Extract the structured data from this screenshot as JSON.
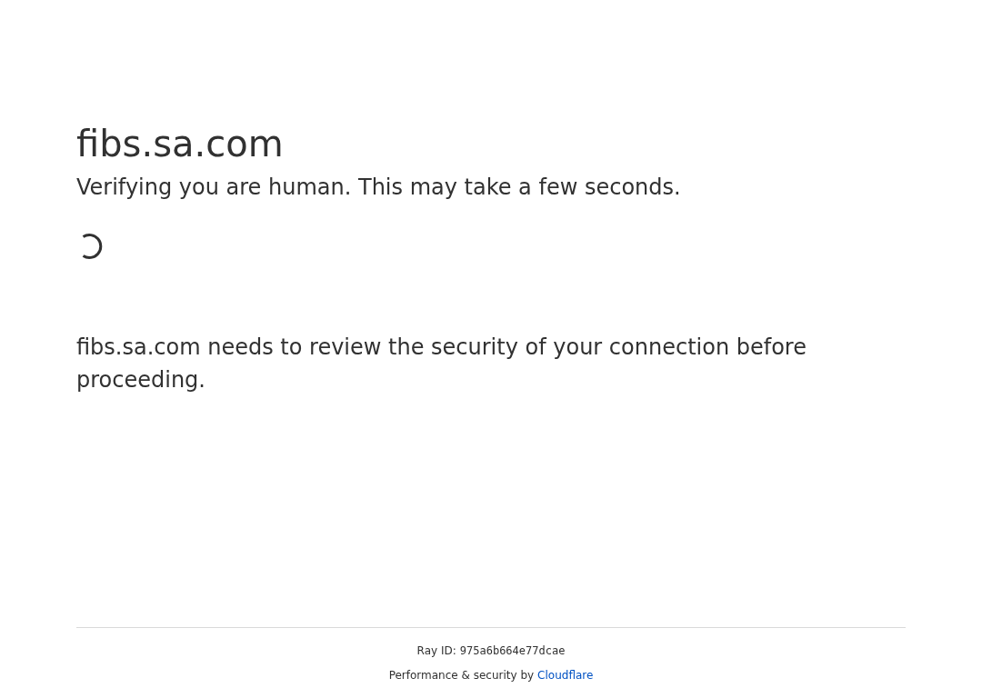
{
  "title": "fibs.sa.com",
  "subtitle": "Verifying you are human. This may take a few seconds.",
  "message": "fibs.sa.com needs to review the security of your connection before proceeding.",
  "footer": {
    "ray_id_label": "Ray ID:",
    "ray_id": "975a6b664e77dcae",
    "credit": "Performance & security by",
    "credit_link": "Cloudflare"
  }
}
